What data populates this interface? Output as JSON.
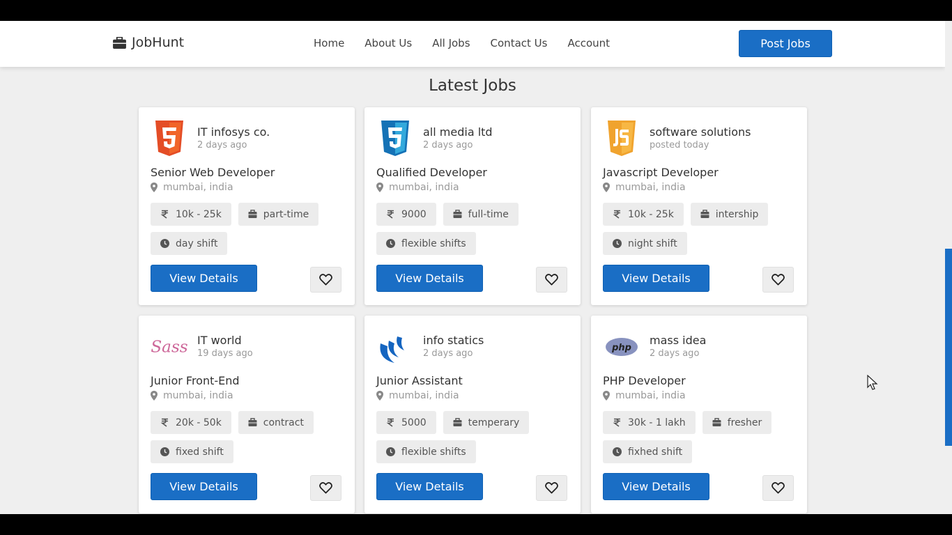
{
  "brand": {
    "name": "JobHunt",
    "icon": "briefcase-icon"
  },
  "nav": {
    "items": [
      "Home",
      "About Us",
      "All Jobs",
      "Contact Us",
      "Account"
    ]
  },
  "header": {
    "post_button": "Post Jobs"
  },
  "section": {
    "title": "Latest Jobs"
  },
  "colors": {
    "accent": "#1a6ec5",
    "tag_bg": "#ececec",
    "page_bg": "#efefef"
  },
  "jobs": [
    {
      "logo": "html5-logo",
      "company": "IT infosys co.",
      "posted": "2 days ago",
      "title": "Senior Web Developer",
      "location": "mumbai, india",
      "salary": "10k - 25k",
      "type": "part-time",
      "shift": "day shift",
      "button": "View Details"
    },
    {
      "logo": "css3-logo",
      "company": "all media ltd",
      "posted": "2 days ago",
      "title": "Qualified Developer",
      "location": "mumbai, india",
      "salary": "9000",
      "type": "full-time",
      "shift": "flexible shifts",
      "button": "View Details"
    },
    {
      "logo": "javascript-logo",
      "company": "software solutions",
      "posted": "posted today",
      "title": "Javascript Developer",
      "location": "mumbai, india",
      "salary": "10k - 25k",
      "type": "intership",
      "shift": "night shift",
      "button": "View Details"
    },
    {
      "logo": "sass-logo",
      "company": "IT world",
      "posted": "19 days ago",
      "title": "Junior Front-End",
      "location": "mumbai, india",
      "salary": "20k - 50k",
      "type": "contract",
      "shift": "fixed shift",
      "button": "View Details"
    },
    {
      "logo": "jquery-logo",
      "company": "info statics",
      "posted": "2 days ago",
      "title": "Junior Assistant",
      "location": "mumbai, india",
      "salary": "5000",
      "type": "temperary",
      "shift": "flexible shifts",
      "button": "View Details"
    },
    {
      "logo": "php-logo",
      "company": "mass idea",
      "posted": "2 days ago",
      "title": "PHP Developer",
      "location": "mumbai, india",
      "salary": "30k - 1 lakh",
      "type": "fresher",
      "shift": "fixhed shift",
      "button": "View Details"
    }
  ],
  "logo_text": {
    "sass": "Sass",
    "php": "php"
  }
}
